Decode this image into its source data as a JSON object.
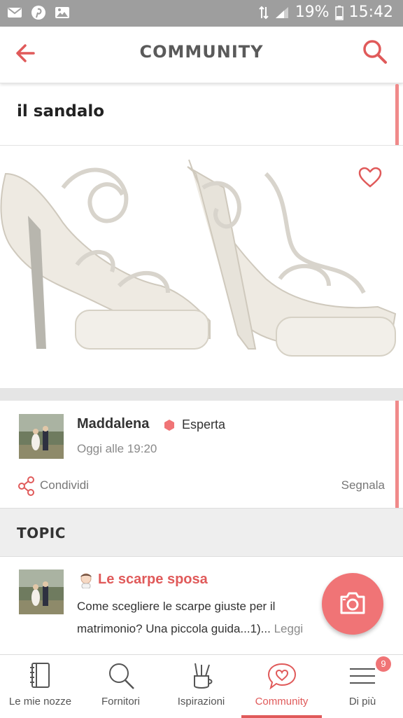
{
  "status_bar": {
    "battery": "19%",
    "time": "15:42"
  },
  "header": {
    "title": "COMMUNITY"
  },
  "post": {
    "title": "il sandalo",
    "author": "Maddalena",
    "author_badge": "Esperta",
    "timestamp": "Oggi alle 19:20",
    "share_label": "Condividi",
    "report_label": "Segnala"
  },
  "topic_section": {
    "heading": "TOPIC",
    "item": {
      "title": "Le scarpe sposa",
      "description": "Come scegliere le scarpe giuste per il matrimonio? Una piccola guida...1)...",
      "read_more": "Leggi tutto"
    }
  },
  "bottom_nav": {
    "items": [
      {
        "label": "Le mie nozze",
        "icon": "notebook-icon"
      },
      {
        "label": "Fornitori",
        "icon": "search-icon"
      },
      {
        "label": "Ispirazioni",
        "icon": "brushes-icon"
      },
      {
        "label": "Community",
        "icon": "chat-heart-icon",
        "active": true
      },
      {
        "label": "Di più",
        "icon": "menu-icon",
        "badge": "9"
      }
    ]
  },
  "colors": {
    "accent": "#e05a5a",
    "fab": "#f07476",
    "status_bar": "#9e9e9e"
  }
}
